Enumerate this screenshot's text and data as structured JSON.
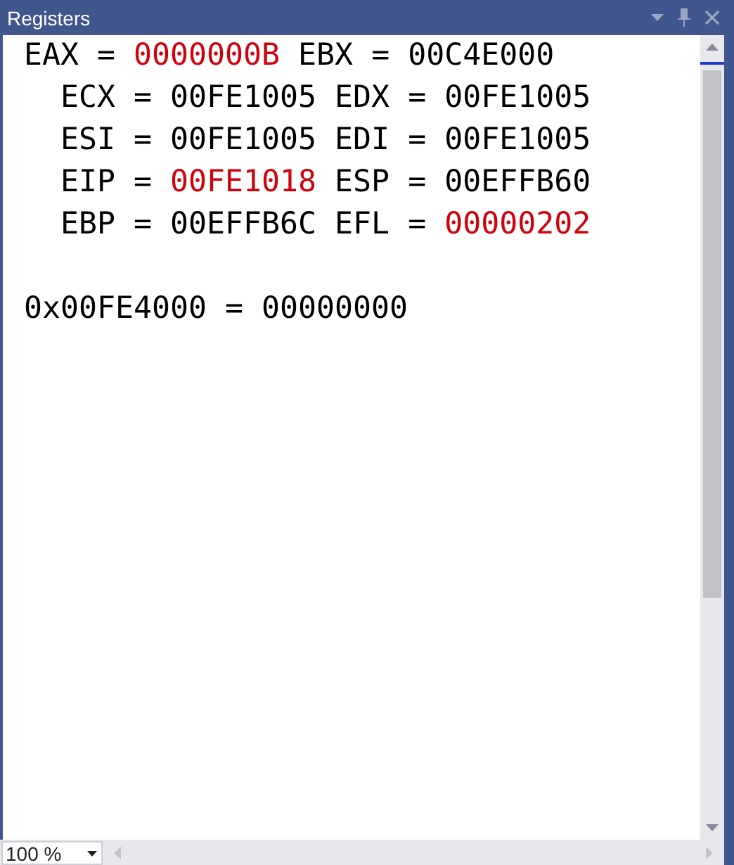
{
  "window": {
    "title": "Registers"
  },
  "register_rows": [
    {
      "registers": [
        {
          "name": "EAX",
          "equals": "=",
          "value": "0000000B",
          "changed": true
        },
        {
          "name": "EBX",
          "equals": "=",
          "value": "00C4E000",
          "changed": false
        }
      ]
    },
    {
      "registers": [
        {
          "name": "ECX",
          "equals": "=",
          "value": "00FE1005",
          "changed": false
        },
        {
          "name": "EDX",
          "equals": "=",
          "value": "00FE1005",
          "changed": false
        }
      ]
    },
    {
      "registers": [
        {
          "name": "ESI",
          "equals": "=",
          "value": "00FE1005",
          "changed": false
        },
        {
          "name": "EDI",
          "equals": "=",
          "value": "00FE1005",
          "changed": false
        }
      ]
    },
    {
      "registers": [
        {
          "name": "EIP",
          "equals": "=",
          "value": "00FE1018",
          "changed": true
        },
        {
          "name": "ESP",
          "equals": "=",
          "value": "00EFFB60",
          "changed": false
        }
      ]
    },
    {
      "registers": [
        {
          "name": "EBP",
          "equals": "=",
          "value": "00EFFB6C",
          "changed": false
        },
        {
          "name": "EFL",
          "equals": "=",
          "value": "00000202",
          "changed": true
        }
      ]
    }
  ],
  "memory": {
    "address": "0x00FE4000",
    "equals": "=",
    "value": "00000000"
  },
  "zoom": {
    "value": "100 %"
  }
}
